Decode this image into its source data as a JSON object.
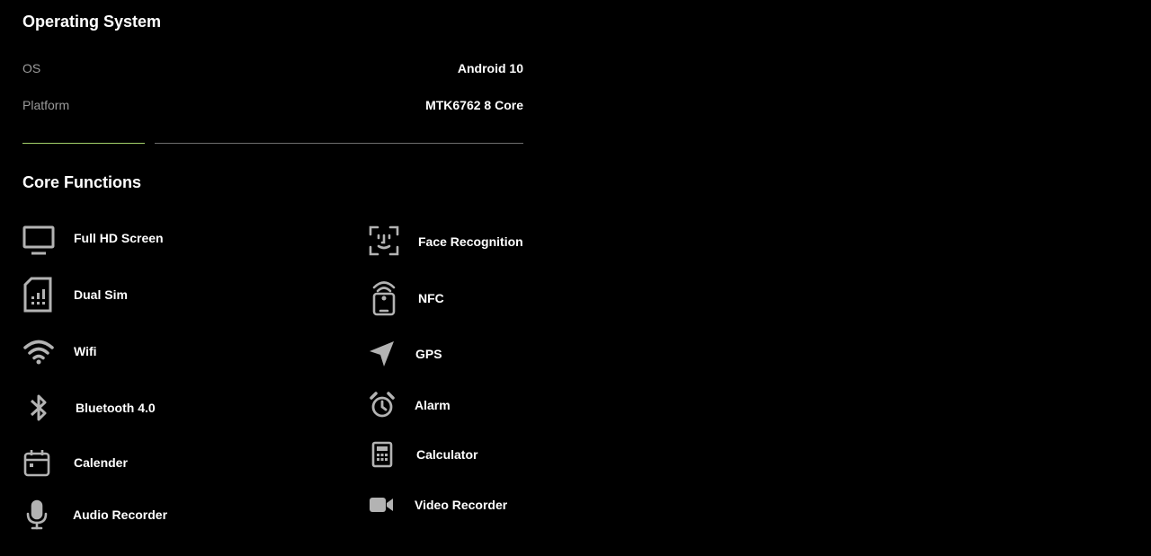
{
  "operating_system": {
    "title": "Operating System",
    "rows": [
      {
        "label": "OS",
        "value": "Android 10"
      },
      {
        "label": "Platform",
        "value": "MTK6762 8 Core"
      }
    ]
  },
  "core_functions": {
    "title": "Core Functions",
    "left": [
      {
        "label": "Full HD Screen",
        "icon": "monitor-icon"
      },
      {
        "label": "Dual Sim",
        "icon": "sim-card-icon"
      },
      {
        "label": "Wifi",
        "icon": "wifi-icon"
      },
      {
        "label": "Bluetooth 4.0",
        "icon": "bluetooth-icon"
      },
      {
        "label": "Calender",
        "icon": "calendar-icon"
      },
      {
        "label": "Audio Recorder",
        "icon": "microphone-icon"
      }
    ],
    "right": [
      {
        "label": "Face Recognition",
        "icon": "face-scan-icon"
      },
      {
        "label": "NFC",
        "icon": "nfc-phone-icon"
      },
      {
        "label": "GPS",
        "icon": "navigation-arrow-icon"
      },
      {
        "label": "Alarm",
        "icon": "alarm-clock-icon"
      },
      {
        "label": "Calculator",
        "icon": "calculator-icon"
      },
      {
        "label": "Video Recorder",
        "icon": "video-camera-icon"
      }
    ]
  },
  "colors": {
    "background": "#000000",
    "text": "#ffffff",
    "muted_label": "#9b9b9b",
    "icon": "#b3b3b3",
    "divider_accent": "#a3d16a",
    "divider": "#6e6e6e"
  }
}
